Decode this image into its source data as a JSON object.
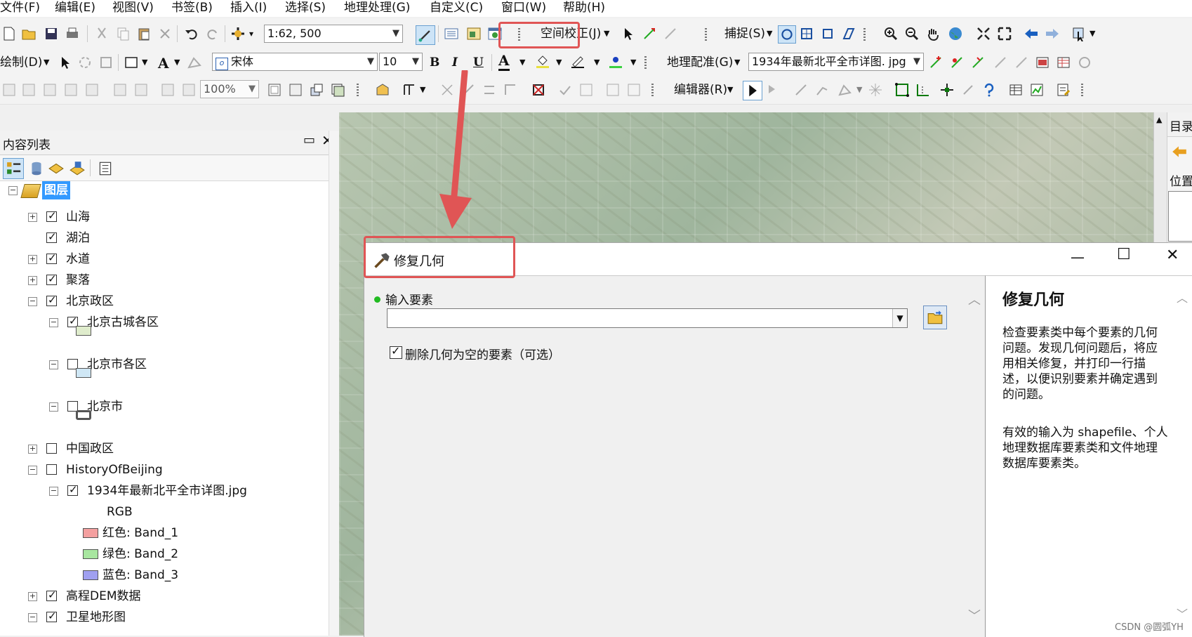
{
  "menu": [
    "文件(F)",
    "编辑(E)",
    "视图(V)",
    "书签(B)",
    "插入(I)",
    "选择(S)",
    "地理处理(G)",
    "自定义(C)",
    "窗口(W)",
    "帮助(H)"
  ],
  "toolbar1": {
    "scale": "1:62, 500",
    "spatial_adjust": "空间校正(J)",
    "snapping": "捕捉(S)"
  },
  "toolbar2": {
    "draw": "绘制(D)",
    "font": "宋体",
    "font_size": "10",
    "bold": "B",
    "italic": "I",
    "underline": "U",
    "font_color": "A",
    "georef": "地理配准(G)",
    "georef_layer": "1934年最新北平全市详图. jpg"
  },
  "toolbar3": {
    "zoom": "100%",
    "editor": "编辑器(R)"
  },
  "toc": {
    "title": "内容列表",
    "root": "图层",
    "items": [
      {
        "label": "山海",
        "checked": true
      },
      {
        "label": "湖泊",
        "checked": true
      },
      {
        "label": "水道",
        "checked": true
      },
      {
        "label": "聚落",
        "checked": true
      },
      {
        "label": "北京政区",
        "checked": true
      },
      {
        "label": "北京古城各区",
        "checked": true
      },
      {
        "label": "北京市各区",
        "checked": false
      },
      {
        "label": "北京市",
        "checked": false
      },
      {
        "label": "中国政区",
        "checked": false
      },
      {
        "label": "HistoryOfBeijing",
        "checked": false
      },
      {
        "label": "1934年最新北平全市详图.jpg",
        "checked": true
      },
      {
        "label": "RGB"
      },
      {
        "label": "红色:    Band_1",
        "color": "#f4a0a0"
      },
      {
        "label": "绿色: Band_2",
        "color": "#a8e6a0"
      },
      {
        "label": "蓝色:    Band_3",
        "color": "#a0a0f0"
      },
      {
        "label": "高程DEM数据",
        "checked": true
      },
      {
        "label": "卫星地形图",
        "checked": true
      }
    ]
  },
  "catalog": {
    "title": "目录",
    "location": "位置"
  },
  "dialog": {
    "title": "修复几何",
    "input_label": "输入要素",
    "input_value": "",
    "option_label": "删除几何为空的要素（可选）",
    "option_checked": true,
    "help_title": "修复几何",
    "help_p1": "检查要素类中每个要素的几何问题。发现几何问题后，将应用相关修复，并打印一行描述，以便识别要素并确定遇到的问题。",
    "help_p2": "有效的输入为 shapefile、个人地理数据库要素类和文件地理数据库要素类。"
  },
  "watermark": "CSDN @圆弧YH",
  "colors": {
    "highlight": "#e05555",
    "selected": "#3399ff",
    "required_dot": "#22bb22"
  }
}
